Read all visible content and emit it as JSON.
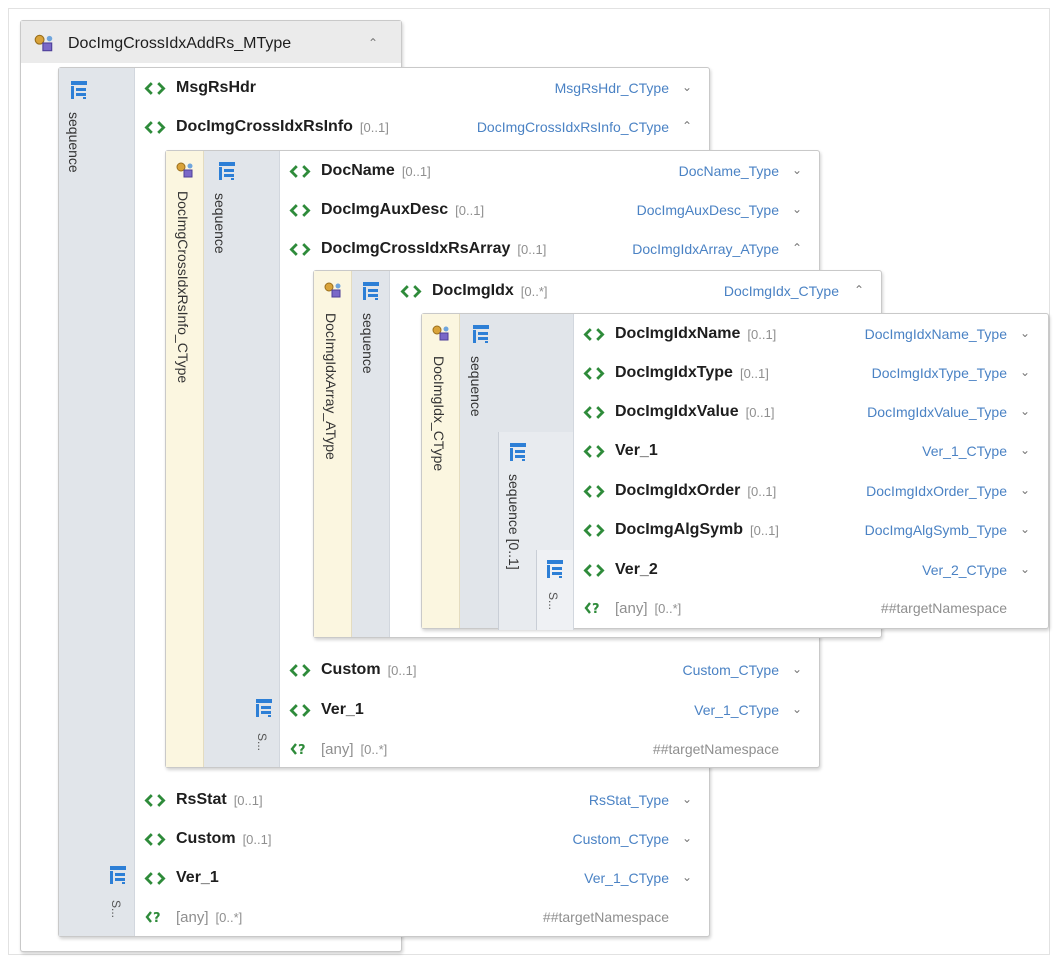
{
  "root": {
    "title": "DocImgCrossIdxAddRs_MType",
    "chevron": "double-up"
  },
  "labels": {
    "sequence": "sequence",
    "sequence_opt": "sequence [0..1]",
    "short_seq": "S...",
    "any": "[any]",
    "any_occ": "[0..*]",
    "target_ns": "##targetNamespace"
  },
  "rs_info": {
    "type_label": "DocImgCrossIdxRsInfo_CType",
    "items": [
      {
        "name": "DocName",
        "occurs": "[0..1]",
        "type": "DocName_Type",
        "chevron": "double-down"
      },
      {
        "name": "DocImgAuxDesc",
        "occurs": "[0..1]",
        "type": "DocImgAuxDesc_Type",
        "chevron": "double-down"
      },
      {
        "name": "DocImgCrossIdxRsArray",
        "occurs": "[0..1]",
        "type": "DocImgIdxArray_AType",
        "chevron": "double-up"
      }
    ],
    "after": [
      {
        "name": "Custom",
        "occurs": "[0..1]",
        "type": "Custom_CType",
        "chevron": "double-down"
      },
      {
        "name": "Ver_1",
        "occurs": "",
        "type": "Ver_1_CType",
        "chevron": "double-down"
      }
    ]
  },
  "outer_items_top": [
    {
      "name": "MsgRsHdr",
      "occurs": "",
      "type": "MsgRsHdr_CType",
      "chevron": "double-down"
    },
    {
      "name": "DocImgCrossIdxRsInfo",
      "occurs": "[0..1]",
      "type": "DocImgCrossIdxRsInfo_CType",
      "chevron": "double-up"
    }
  ],
  "outer_items_bottom": [
    {
      "name": "RsStat",
      "occurs": "[0..1]",
      "type": "RsStat_Type",
      "chevron": "double-down"
    },
    {
      "name": "Custom",
      "occurs": "[0..1]",
      "type": "Custom_CType",
      "chevron": "double-down"
    },
    {
      "name": "Ver_1",
      "occurs": "",
      "type": "Ver_1_CType",
      "chevron": "double-down"
    }
  ],
  "array": {
    "type_label": "DocImgIdxArray_AType",
    "item": {
      "name": "DocImgIdx",
      "occurs": "[0..*]",
      "type": "DocImgIdx_CType",
      "chevron": "double-up"
    }
  },
  "idx": {
    "type_label": "DocImgIdx_CType",
    "items": [
      {
        "name": "DocImgIdxName",
        "occurs": "[0..1]",
        "type": "DocImgIdxName_Type",
        "chevron": "double-down"
      },
      {
        "name": "DocImgIdxType",
        "occurs": "[0..1]",
        "type": "DocImgIdxType_Type",
        "chevron": "double-down"
      },
      {
        "name": "DocImgIdxValue",
        "occurs": "[0..1]",
        "type": "DocImgIdxValue_Type",
        "chevron": "double-down"
      },
      {
        "name": "Ver_1",
        "occurs": "",
        "type": "Ver_1_CType",
        "chevron": "double-down"
      },
      {
        "name": "DocImgIdxOrder",
        "occurs": "[0..1]",
        "type": "DocImgIdxOrder_Type",
        "chevron": "double-down"
      },
      {
        "name": "DocImgAlgSymb",
        "occurs": "[0..1]",
        "type": "DocImgAlgSymb_Type",
        "chevron": "double-down"
      },
      {
        "name": "Ver_2",
        "occurs": "",
        "type": "Ver_2_CType",
        "chevron": "double-down"
      }
    ]
  },
  "colors": {
    "type_link": "#4a82c4",
    "element_icon": "#2e8b3a",
    "sequence_icon": "#2d7fd6",
    "complex_type_strip": "#fbf6e0",
    "sequence_strip": "#e1e5ea"
  }
}
